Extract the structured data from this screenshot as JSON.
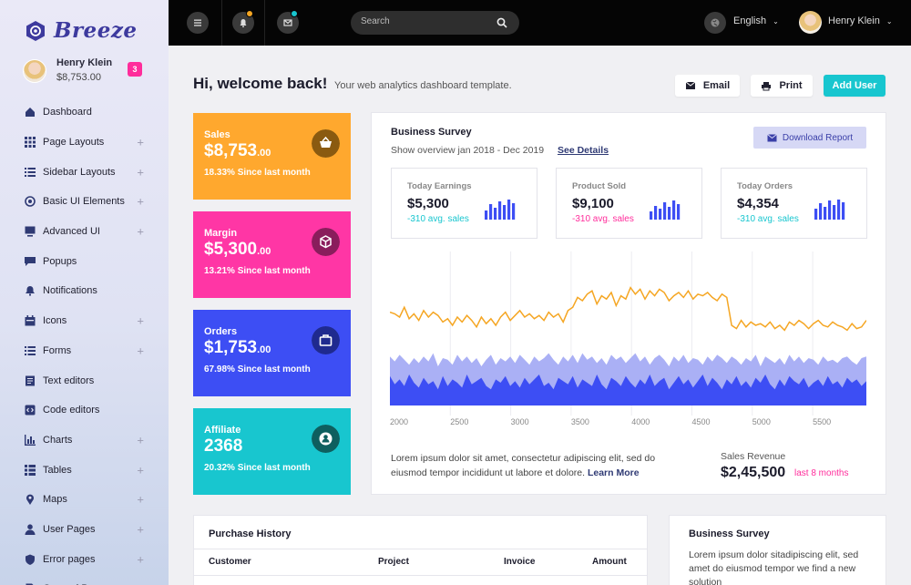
{
  "brand": {
    "name": "Breeze"
  },
  "profile": {
    "name": "Henry Klein",
    "balance": "$8,753.00",
    "badge": "3"
  },
  "sidebar": {
    "items": [
      {
        "label": "Dashboard",
        "icon": "home-icon",
        "expandable": false
      },
      {
        "label": "Page Layouts",
        "icon": "grid-icon",
        "expandable": true
      },
      {
        "label": "Sidebar Layouts",
        "icon": "list-icon",
        "expandable": true
      },
      {
        "label": "Basic UI Elements",
        "icon": "target-icon",
        "expandable": true
      },
      {
        "label": "Advanced UI",
        "icon": "monitor-icon",
        "expandable": true
      },
      {
        "label": "Popups",
        "icon": "chat-icon",
        "expandable": false
      },
      {
        "label": "Notifications",
        "icon": "bell-icon",
        "expandable": false
      },
      {
        "label": "Icons",
        "icon": "calendar-icon",
        "expandable": true
      },
      {
        "label": "Forms",
        "icon": "list-icon",
        "expandable": true
      },
      {
        "label": "Text editors",
        "icon": "document-icon",
        "expandable": false
      },
      {
        "label": "Code editors",
        "icon": "code-icon",
        "expandable": false
      },
      {
        "label": "Charts",
        "icon": "bar-chart-icon",
        "expandable": true
      },
      {
        "label": "Tables",
        "icon": "table-icon",
        "expandable": true
      },
      {
        "label": "Maps",
        "icon": "map-pin-icon",
        "expandable": true
      },
      {
        "label": "User Pages",
        "icon": "user-icon",
        "expandable": true
      },
      {
        "label": "Error pages",
        "icon": "shield-icon",
        "expandable": true
      },
      {
        "label": "General Pages",
        "icon": "file-icon",
        "expandable": true
      }
    ]
  },
  "topbar": {
    "search_placeholder": "Search",
    "language": "English",
    "user_name": "Henry Klein",
    "notification_dot_color": "#f5a623",
    "message_dot_color": "#18c6cf"
  },
  "header": {
    "title": "Hi, welcome back!",
    "subtitle": "Your web analytics dashboard template.",
    "email_label": "Email",
    "print_label": "Print",
    "add_user_label": "Add User"
  },
  "stats": [
    {
      "title": "Sales",
      "value": "$8,753",
      "cents": ".00",
      "sub": "18.33% Since last month",
      "color": "#ffa82e",
      "icon": "basket-icon"
    },
    {
      "title": "Margin",
      "value": "$5,300",
      "cents": ".00",
      "sub": "13.21% Since last month",
      "color": "#ff36a5",
      "icon": "cube-icon"
    },
    {
      "title": "Orders",
      "value": "$1,753",
      "cents": ".00",
      "sub": "67.98% Since last month",
      "color": "#3d4ef4",
      "icon": "briefcase-icon"
    },
    {
      "title": "Affiliate",
      "value": "2368",
      "cents": "",
      "sub": "20.32% Since last month",
      "color": "#18c6cf",
      "icon": "user-circle-icon"
    }
  ],
  "survey": {
    "title": "Business Survey",
    "subtitle": "Show overview jan 2018 - Dec 2019",
    "link": "See Details",
    "download_label": "Download Report",
    "minis": [
      {
        "title": "Today Earnings",
        "value": "$5,300",
        "sub": "-310 avg. sales",
        "sub_color": "#18c6cf"
      },
      {
        "title": "Product Sold",
        "value": "$9,100",
        "sub": "-310 avg. sales",
        "sub_color": "#ff2d9b"
      },
      {
        "title": "Today Orders",
        "value": "$4,354",
        "sub": "-310 avg. sales",
        "sub_color": "#18c6cf"
      }
    ],
    "text": "Lorem ipsum dolor sit amet, consectetur adipiscing elit, sed do eiusmod tempor incididunt ut labore et dolore.",
    "learn_more": "Learn More",
    "revenue_label": "Sales Revenue",
    "revenue_value": "$2,45,500",
    "revenue_period": "last 8 months"
  },
  "chart_data": {
    "type": "line",
    "x_ticks": [
      "2000",
      "2500",
      "3000",
      "3500",
      "4000",
      "4500",
      "5000",
      "5500"
    ],
    "series": [
      {
        "kind": "line",
        "color": "#f5a623",
        "values": [
          63,
          62,
          60,
          66,
          59,
          62,
          58,
          64,
          60,
          63,
          61,
          57,
          59,
          55,
          60,
          57,
          61,
          58,
          54,
          60,
          56,
          59,
          55,
          60,
          63,
          58,
          61,
          64,
          60,
          62,
          59,
          61,
          58,
          63,
          60,
          62,
          57,
          64,
          66,
          72,
          70,
          74,
          76,
          68,
          73,
          71,
          75,
          67,
          73,
          71,
          78,
          74,
          77,
          71,
          76,
          73,
          77,
          75,
          70,
          73,
          75,
          72,
          76,
          71,
          74,
          73,
          75,
          72,
          70,
          74,
          72,
          55,
          53,
          58,
          54,
          57,
          55,
          56,
          54,
          57,
          53,
          55,
          52,
          57,
          55,
          58,
          56,
          53,
          56,
          58,
          55,
          54,
          57,
          55,
          54,
          52,
          56,
          53,
          54,
          58
        ]
      },
      {
        "kind": "area",
        "color": "#aab0f5",
        "values": [
          36,
          33,
          37,
          34,
          31,
          35,
          32,
          36,
          33,
          38,
          30,
          35,
          34,
          31,
          37,
          33,
          36,
          32,
          35,
          30,
          34,
          37,
          31,
          35,
          33,
          36,
          32,
          37,
          34,
          31,
          36,
          33,
          35,
          38,
          34,
          31,
          36,
          33,
          37,
          32,
          38,
          34,
          36,
          32,
          35,
          31,
          37,
          34,
          36,
          32,
          35,
          38,
          33,
          36,
          31,
          35,
          37,
          34,
          30,
          36,
          33,
          37,
          32,
          35,
          34,
          31,
          36,
          33,
          37,
          35,
          32,
          36,
          34,
          31,
          35,
          33,
          37,
          30,
          36,
          34,
          32,
          35,
          31,
          37,
          33,
          36,
          32,
          35,
          34,
          31,
          36,
          33,
          34,
          32,
          35,
          36,
          33,
          31,
          35,
          36
        ]
      },
      {
        "kind": "area",
        "color": "#3d4ef4",
        "values": [
          24,
          19,
          22,
          18,
          25,
          20,
          17,
          23,
          19,
          21,
          16,
          24,
          18,
          22,
          20,
          17,
          25,
          19,
          21,
          23,
          18,
          16,
          22,
          20,
          24,
          18,
          21,
          17,
          23,
          19,
          22,
          25,
          18,
          20,
          16,
          23,
          21,
          19,
          24,
          17,
          22,
          20,
          18,
          25,
          19,
          16,
          23,
          21,
          18,
          24,
          20,
          17,
          22,
          19,
          25,
          18,
          21,
          23,
          16,
          20,
          24,
          19,
          22,
          17,
          21,
          25,
          18,
          23,
          20,
          16,
          22,
          19,
          24,
          18,
          21,
          17,
          23,
          20,
          25,
          19,
          16,
          22,
          18,
          24,
          21,
          19,
          23,
          17,
          20,
          22,
          18,
          24,
          19,
          21,
          17,
          23,
          20,
          22,
          18,
          21
        ]
      }
    ],
    "ylim": [
      0,
      100
    ],
    "grid": true
  },
  "purchase_history": {
    "title": "Purchase History",
    "columns": [
      "Customer",
      "Project",
      "Invoice",
      "Amount"
    ]
  },
  "survey2": {
    "title": "Business Survey",
    "text": "Lorem ipsum dolor sitadipiscing elit, sed amet do eiusmod tempor we find a new solution"
  }
}
